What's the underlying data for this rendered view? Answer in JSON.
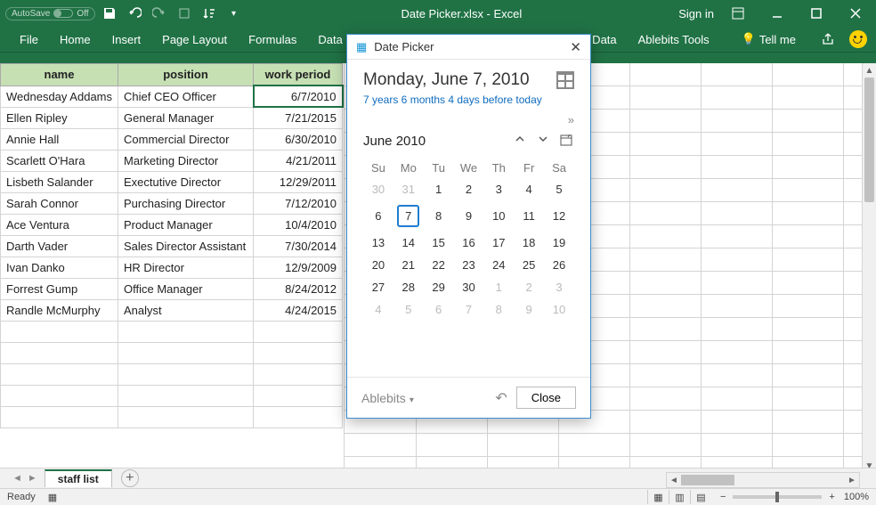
{
  "titlebar": {
    "autosave_label": "AutoSave",
    "autosave_state": "Off",
    "title": "Date Picker.xlsx - Excel",
    "signin": "Sign in"
  },
  "ribbon": {
    "tabs": [
      "File",
      "Home",
      "Insert",
      "Page Layout",
      "Formulas",
      "Data"
    ],
    "right_tabs": [
      "its Data",
      "Ablebits Tools"
    ],
    "tell_me": "Tell me"
  },
  "sheet": {
    "headers": {
      "name": "name",
      "position": "position",
      "work_period": "work period"
    },
    "rows": [
      {
        "name": "Wednesday Addams",
        "position": "Chief CEO Officer",
        "date": "6/7/2010"
      },
      {
        "name": "Ellen Ripley",
        "position": "General Manager",
        "date": "7/21/2015"
      },
      {
        "name": "Annie Hall",
        "position": "Commercial Director",
        "date": "6/30/2010"
      },
      {
        "name": "Scarlett O'Hara",
        "position": "Marketing Director",
        "date": "4/21/2011"
      },
      {
        "name": "Lisbeth Salander",
        "position": "Exectutive Director",
        "date": "12/29/2011"
      },
      {
        "name": "Sarah Connor",
        "position": "Purchasing Director",
        "date": "7/12/2010"
      },
      {
        "name": "Ace Ventura",
        "position": "Product Manager",
        "date": "10/4/2010"
      },
      {
        "name": "Darth Vader",
        "position": "Sales Director Assistant",
        "date": "7/30/2014"
      },
      {
        "name": "Ivan Danko",
        "position": "HR Director",
        "date": "12/9/2009"
      },
      {
        "name": "Forrest Gump",
        "position": "Office Manager",
        "date": "8/24/2012"
      },
      {
        "name": "Randle McMurphy",
        "position": "Analyst",
        "date": "4/24/2015"
      }
    ]
  },
  "tabs": {
    "active": "staff list"
  },
  "status": {
    "ready": "Ready",
    "zoom": "100%"
  },
  "picker": {
    "title": "Date Picker",
    "bigdate": "Monday, June 7, 2010",
    "relative": "7 years 6 months 4 days before today",
    "month_label": "June 2010",
    "dow": [
      "Su",
      "Mo",
      "Tu",
      "We",
      "Th",
      "Fr",
      "Sa"
    ],
    "grid": [
      [
        {
          "d": "30",
          "o": true
        },
        {
          "d": "31",
          "o": true
        },
        {
          "d": "1"
        },
        {
          "d": "2"
        },
        {
          "d": "3"
        },
        {
          "d": "4"
        },
        {
          "d": "5"
        }
      ],
      [
        {
          "d": "6"
        },
        {
          "d": "7",
          "sel": true
        },
        {
          "d": "8"
        },
        {
          "d": "9"
        },
        {
          "d": "10"
        },
        {
          "d": "11"
        },
        {
          "d": "12"
        }
      ],
      [
        {
          "d": "13"
        },
        {
          "d": "14"
        },
        {
          "d": "15"
        },
        {
          "d": "16"
        },
        {
          "d": "17"
        },
        {
          "d": "18"
        },
        {
          "d": "19"
        }
      ],
      [
        {
          "d": "20"
        },
        {
          "d": "21"
        },
        {
          "d": "22"
        },
        {
          "d": "23"
        },
        {
          "d": "24"
        },
        {
          "d": "25"
        },
        {
          "d": "26"
        }
      ],
      [
        {
          "d": "27"
        },
        {
          "d": "28"
        },
        {
          "d": "29"
        },
        {
          "d": "30"
        },
        {
          "d": "1",
          "o": true
        },
        {
          "d": "2",
          "o": true
        },
        {
          "d": "3",
          "o": true
        }
      ],
      [
        {
          "d": "4",
          "o": true
        },
        {
          "d": "5",
          "o": true
        },
        {
          "d": "6",
          "o": true
        },
        {
          "d": "7",
          "o": true
        },
        {
          "d": "8",
          "o": true
        },
        {
          "d": "9",
          "o": true
        },
        {
          "d": "10",
          "o": true
        }
      ]
    ],
    "footer_brand": "Ablebits",
    "close": "Close"
  }
}
